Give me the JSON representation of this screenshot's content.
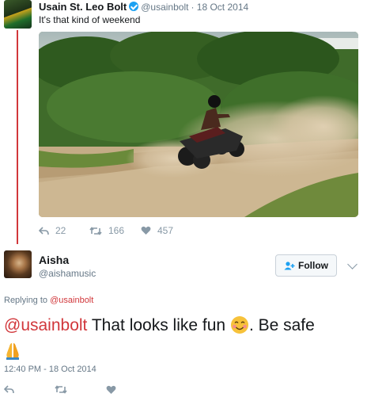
{
  "tweet": {
    "author_name": "Usain St. Leo Bolt",
    "author_handle": "@usainbolt",
    "date": "· 18 Oct 2014",
    "text": "It's that kind of weekend",
    "replies": "22",
    "retweets": "166",
    "likes": "457"
  },
  "reply": {
    "author_name": "Aisha",
    "author_handle": "@aishamusic",
    "follow_label": "Follow",
    "replying_prefix": "Replying to",
    "replying_to": "@usainbolt",
    "mention": "@usainbolt",
    "text_main": " That looks like fun ",
    "text_after": ". Be safe",
    "timestamp": "12:40 PM - 18 Oct 2014"
  },
  "colors": {
    "accent": "#d1373b",
    "verified": "#1da1f2",
    "muted": "#657786",
    "icon": "#8899a6"
  },
  "icons": [
    "verified-badge-icon",
    "reply-icon",
    "retweet-icon",
    "like-icon",
    "add-user-icon",
    "chevron-down-icon",
    "smiling-face-emoji",
    "folded-hands-emoji"
  ]
}
